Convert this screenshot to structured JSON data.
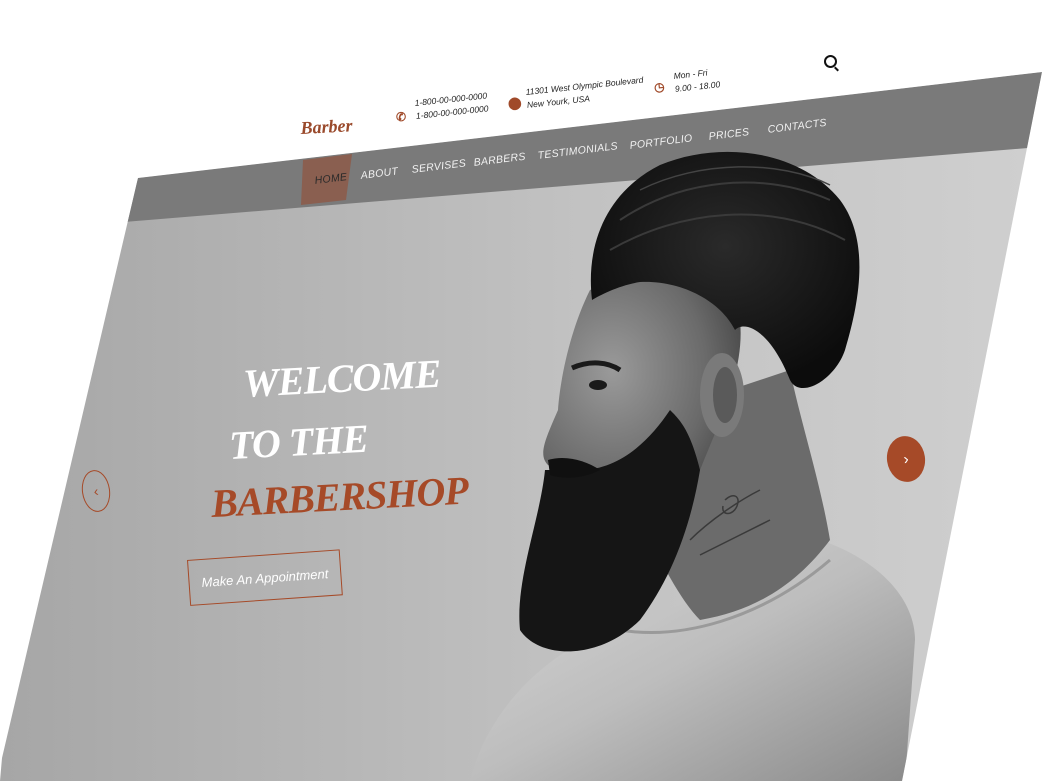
{
  "brand": {
    "logo_text": "Barber",
    "accent_color": "#a64a28"
  },
  "topbar": {
    "phone": {
      "icon": "phone-icon",
      "line1": "1-800-00-000-0000",
      "line2": "1-800-00-000-0000"
    },
    "address": {
      "icon": "map-pin-icon",
      "line1": "11301 West Olympic Boulevard",
      "line2": "New Yourk, USA"
    },
    "hours": {
      "icon": "clock-icon",
      "line1": "Mon - Fri",
      "line2": "9.00 - 18.00"
    },
    "search_icon": "search-icon"
  },
  "nav": {
    "items": [
      {
        "label": "HOME",
        "active": true
      },
      {
        "label": "ABOUT",
        "active": false
      },
      {
        "label": "SERVISES",
        "active": false
      },
      {
        "label": "BARBERS",
        "active": false
      },
      {
        "label": "TESTIMONIALS",
        "active": false
      },
      {
        "label": "PORTFOLIO",
        "active": false
      },
      {
        "label": "PRICES",
        "active": false
      },
      {
        "label": "CONTACTS",
        "active": false
      }
    ]
  },
  "hero": {
    "line1": "WELCOME",
    "line2": "TO THE",
    "line3": "BARBERSHOP",
    "cta_label": "Make An Appointment",
    "prev_icon": "chevron-left-icon",
    "next_icon": "chevron-right-icon",
    "prev_glyph": "‹",
    "next_glyph": "›"
  }
}
